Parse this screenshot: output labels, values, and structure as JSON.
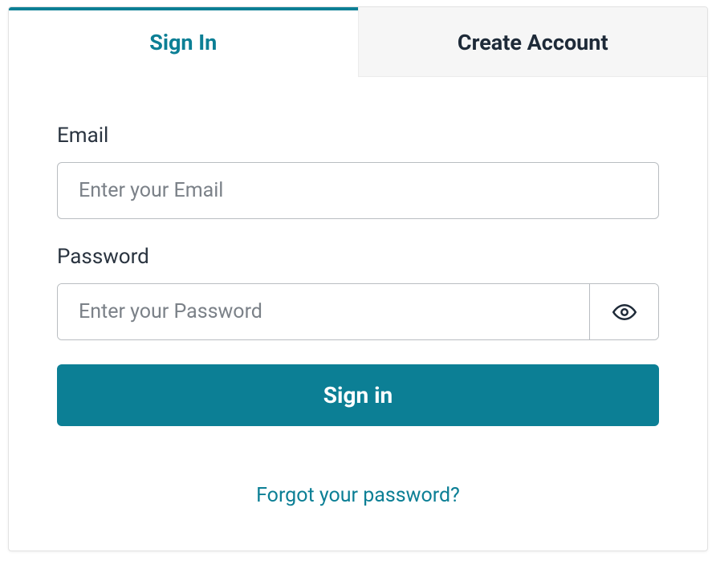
{
  "tabs": {
    "signin": "Sign In",
    "create": "Create Account"
  },
  "form": {
    "email_label": "Email",
    "email_placeholder": "Enter your Email",
    "password_label": "Password",
    "password_placeholder": "Enter your Password",
    "submit_label": "Sign in"
  },
  "links": {
    "forgot": "Forgot your password?"
  },
  "colors": {
    "accent": "#0c7f95"
  }
}
